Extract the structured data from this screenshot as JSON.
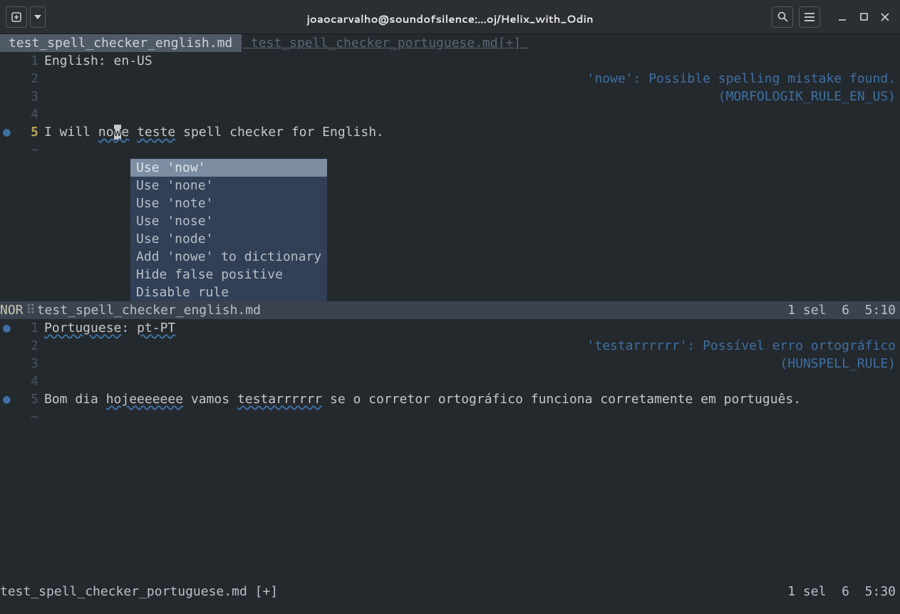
{
  "window": {
    "title": "joaocarvalho@soundofsilence:...oj/Helix_with_Odin"
  },
  "tabs": {
    "active": "test_spell_checker_english.md ",
    "inactive": " test_spell_checker_portuguese.md[+] "
  },
  "pane1": {
    "lines": {
      "l1": "English: en-US",
      "l5_pre": "I will ",
      "l5_err1a": "no",
      "l5_cursor": "w",
      "l5_err1b": "e",
      "l5_mid": " ",
      "l5_err2": "teste",
      "l5_post": " spell checker for English."
    },
    "diag1": "'nowe': Possible spelling mistake found.",
    "diag2": "(MORFOLOGIK_RULE_EN_US)",
    "popup": {
      "i0": "Use 'now'",
      "i1": "Use 'none'",
      "i2": "Use 'note'",
      "i3": "Use 'nose'",
      "i4": "Use 'node'",
      "i5": "Add 'nowe' to dictionary",
      "i6": "Hide false positive",
      "i7": "Disable rule"
    },
    "status": {
      "mode": "NOR",
      "file": "test_spell_checker_english.md",
      "sel": "1 sel",
      "count": "6",
      "pos": "5:10"
    }
  },
  "pane2": {
    "lines": {
      "l1_err1": "Portuguese",
      "l1_mid": ": ",
      "l1_err2": "pt-PT",
      "l5_pre": "Bom dia ",
      "l5_err1": "hojeeeeeee",
      "l5_mid1": " vamos ",
      "l5_err2": "testarrrrrr",
      "l5_post": " se o corretor ortográfico funciona corretamente em português."
    },
    "diag1": "'testarrrrrr': Possível erro ortográfico",
    "diag2": "(HUNSPELL_RULE)",
    "status": {
      "file": "test_spell_checker_portuguese.md [+]",
      "sel": "1 sel",
      "count": "6",
      "pos": "5:30"
    }
  },
  "linenums": {
    "n1": "1",
    "n2": "2",
    "n3": "3",
    "n4": "4",
    "n5": "5",
    "tilde": "~"
  }
}
